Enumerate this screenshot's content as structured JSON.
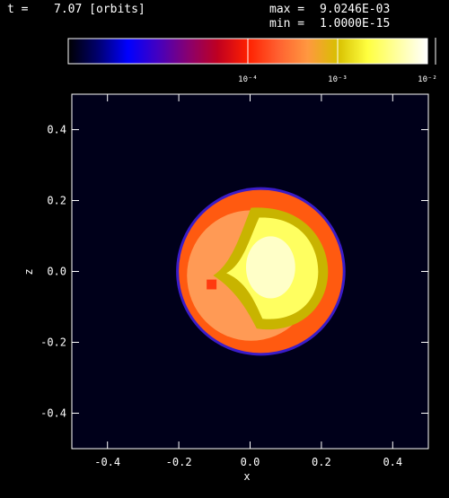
{
  "header": {
    "time_label": "t =",
    "time_value": "7.07 [orbits]",
    "max_label": "max =",
    "max_value": "9.0246E-03",
    "min_label": "min =",
    "min_value": "1.0000E-15"
  },
  "colorbar": {
    "ticks": [
      {
        "label": "10⁻⁴",
        "value": 0.0001
      },
      {
        "label": "10⁻³",
        "value": 0.001
      },
      {
        "label": "10⁻²",
        "value": 0.01
      }
    ],
    "log_min": 1e-06,
    "log_max": 0.01,
    "colors": [
      "#000000",
      "#000070",
      "#0000ff",
      "#4400c0",
      "#880070",
      "#c00020",
      "#ff2000",
      "#ff6030",
      "#ff9840",
      "#d8c000",
      "#ffff40",
      "#ffffa0",
      "#ffffff"
    ]
  },
  "chart_data": {
    "type": "heatmap",
    "title": "",
    "xlabel": "x",
    "ylabel": "z",
    "xlim": [
      -0.5,
      0.5
    ],
    "ylim": [
      -0.5,
      0.5
    ],
    "xticks": [
      "-0.4",
      "-0.2",
      "0.0",
      "0.2",
      "0.4"
    ],
    "yticks": [
      "-0.4",
      "-0.2",
      "0.0",
      "0.2",
      "0.4"
    ],
    "xtick_values": [
      -0.4,
      -0.2,
      0.0,
      0.2,
      0.4
    ],
    "ytick_values": [
      -0.4,
      -0.2,
      0.0,
      0.2,
      0.4
    ],
    "background_color": "#00001a",
    "blob": {
      "center": [
        0.03,
        0.0
      ],
      "radius": 0.23,
      "colors": {
        "rim": "#3a1cc8",
        "outer": "#ff5a10",
        "mid": "#ff9a55",
        "ring": "#c8b400",
        "core": "#ffff60",
        "hot": "#ffffc8"
      }
    }
  }
}
